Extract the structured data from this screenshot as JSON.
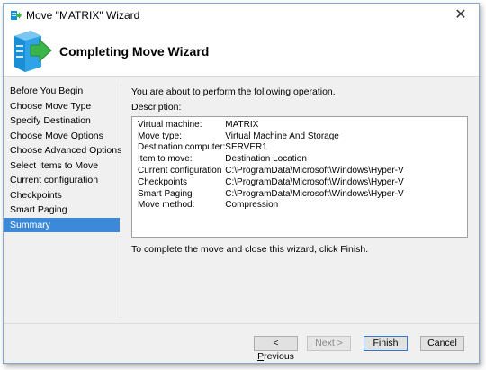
{
  "window": {
    "title": "Move \"MATRIX\" Wizard",
    "close_glyph": "✕"
  },
  "header": {
    "title": "Completing Move Wizard",
    "icon": "server-arrow-icon"
  },
  "sidebar": {
    "items": [
      {
        "label": "Before You Begin",
        "active": false
      },
      {
        "label": "Choose Move Type",
        "active": false
      },
      {
        "label": "Specify Destination",
        "active": false
      },
      {
        "label": "Choose Move Options",
        "active": false
      },
      {
        "label": "Choose Advanced Options",
        "active": false
      },
      {
        "label": "Select Items to Move",
        "active": false
      },
      {
        "label": "Current configuration",
        "active": false
      },
      {
        "label": "Checkpoints",
        "active": false
      },
      {
        "label": "Smart Paging",
        "active": false
      },
      {
        "label": "Summary",
        "active": true
      }
    ]
  },
  "main": {
    "intro": "You are about to perform the following operation.",
    "description_label": "Description:",
    "details": [
      {
        "key": "Virtual machine:",
        "value": "MATRIX"
      },
      {
        "key": "Move type:",
        "value": "Virtual Machine And Storage"
      },
      {
        "key": "Destination computer:",
        "value": "SERVER1"
      },
      {
        "key": "Item to move:",
        "value": "Destination Location"
      },
      {
        "key": "Current configuration",
        "value": "C:\\ProgramData\\Microsoft\\Windows\\Hyper-V"
      },
      {
        "key": "Checkpoints",
        "value": "C:\\ProgramData\\Microsoft\\Windows\\Hyper-V"
      },
      {
        "key": "Smart Paging",
        "value": "C:\\ProgramData\\Microsoft\\Windows\\Hyper-V"
      },
      {
        "key": "Move method:",
        "value": "Compression"
      }
    ],
    "finish_text": "To complete the move and close this wizard, click Finish."
  },
  "buttons": {
    "previous": {
      "prefix": "< ",
      "mnemonic": "P",
      "rest": "revious"
    },
    "next": {
      "mnemonic": "N",
      "rest": "ext >"
    },
    "finish": {
      "mnemonic": "F",
      "rest": "inish"
    },
    "cancel": {
      "label": "Cancel"
    }
  },
  "colors": {
    "selection": "#3c8ad7",
    "icon_blue": "#1a8fd6",
    "icon_green": "#3bb54a"
  }
}
